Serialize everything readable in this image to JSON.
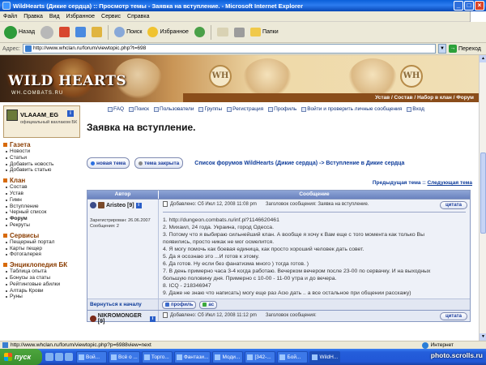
{
  "window": {
    "title": "WildHearts (Дикие сердца) :: Просмотр темы - Заявка на вступление. - Microsoft Internet Explorer",
    "buttons": [
      "_",
      "□",
      "×"
    ]
  },
  "menu": [
    "Файл",
    "Правка",
    "Вид",
    "Избранное",
    "Сервис",
    "Справка"
  ],
  "toolbar": {
    "back": "Назад",
    "search": "Поиск",
    "favorites": "Избранное",
    "folders": "Папки"
  },
  "address": {
    "label": "Адрес:",
    "url": "http://www.whclan.ru/forum/viewtopic.php?t=698",
    "go": "Переход"
  },
  "banner": {
    "logo": "WILD HEARTS",
    "logo_sub": "WH.COMBATS.RU",
    "emblem": "WH",
    "nav": "Устав / Состав / Набор в клан / Форум"
  },
  "user": {
    "name": "VLAAAM_EG",
    "label": "официальный вахлаком БК"
  },
  "sidebar": [
    {
      "title": "Газета",
      "items": [
        "Новости",
        "Статьи",
        "Добавить новость",
        "Добавить статью"
      ]
    },
    {
      "title": "Клан",
      "items": [
        "Состав",
        "Устав",
        "Гимн",
        "Вступление",
        "Черный список",
        "Форум",
        "Рекруты"
      ]
    },
    {
      "title": "Сервисы",
      "items": [
        "Пещерный портал",
        "Карты пещер",
        "Фотогалерея"
      ]
    },
    {
      "title": "Энциклопедия БК",
      "items": [
        "Таблица опыта",
        "Бонусы за статы",
        "Рейтинговые абилки",
        "Алтарь Крови",
        "Руны"
      ]
    }
  ],
  "toplinks": [
    "FAQ",
    "Поиск",
    "Пользователи",
    "Группы",
    "Регистрация",
    "Профиль",
    "Войти и проверить личные сообщения",
    "Вход"
  ],
  "topic": {
    "title": "Заявка на вступление.",
    "new_topic": "новая тема",
    "topic_closed": "тема закрыта",
    "breadcrumb": "Список форумов WildHearts (Дикие сердца) -> Вступление в Дикие сердца",
    "prev_next": "Предыдущая тема :: Следующая тема",
    "prev": "Предыдущая тема",
    "sep": "::",
    "next": "Следующая тема"
  },
  "table": {
    "col_author": "Автор",
    "col_message": "Сообщение"
  },
  "posts": [
    {
      "author": "Aristeo [9]",
      "registered": "Зарегистрирован: 26.06.2007",
      "messages": "Сообщения: 2",
      "added": "Добавлено: Сб Июл 12, 2008 11:08 pm",
      "subject": "Заголовок сообщения: Заявка на вступление.",
      "quote": "цитата",
      "lines": [
        "1. http://dungeon.combats.ru/inf.pl?1146620461",
        "2. Михаил, 24 года. Украина, город Одесса.",
        "3. Потому что я выбираю сильнейший клан. А вообще я хочу к Вам еще с того момента как только Вы",
        "появились, просто никак не мог осмелится.",
        "4. Я могу помочь как боевая единица, как просто хороший человек дать совет.",
        "5. Да я осознаю это ...И готов к этому.",
        "6. Да готов. Ну если без фанатизма много ) тогда готов. )",
        "7. В день примерно часа 3-4 когда работаю. Вечерком вечером после 23-00 по сервачку. И на выходных",
        "большую половину дня. Примерно с 10-00 - 11-00 утра и до вечера.",
        "8. ICQ - 218346947",
        "9. Даже не знаю что написать) могу еще раз Асю дать .. а все остальное при общении расскажу)"
      ],
      "back_top": "Вернуться к началу",
      "profile_btn": "профиль",
      "icq_btn": "ас"
    },
    {
      "author": "NIKROMONGER [9]",
      "added": "Добавлено: Сб Июл 12, 2008 11:12 pm",
      "subject": "Заголовок сообщения:",
      "quote": "цитата"
    }
  ],
  "status": {
    "url": "http://www.whclan.ru/forum/viewtopic.php?p=6988view=next",
    "zone": "Интернет"
  },
  "taskbar": {
    "start": "пуск",
    "tasks": [
      "Вой...",
      "Всё о ...",
      "Торго...",
      "Фантази...",
      "Моди...",
      "[342-...",
      "Бой...",
      "WildH..."
    ]
  },
  "watermark": "photo.scrolls.ru"
}
